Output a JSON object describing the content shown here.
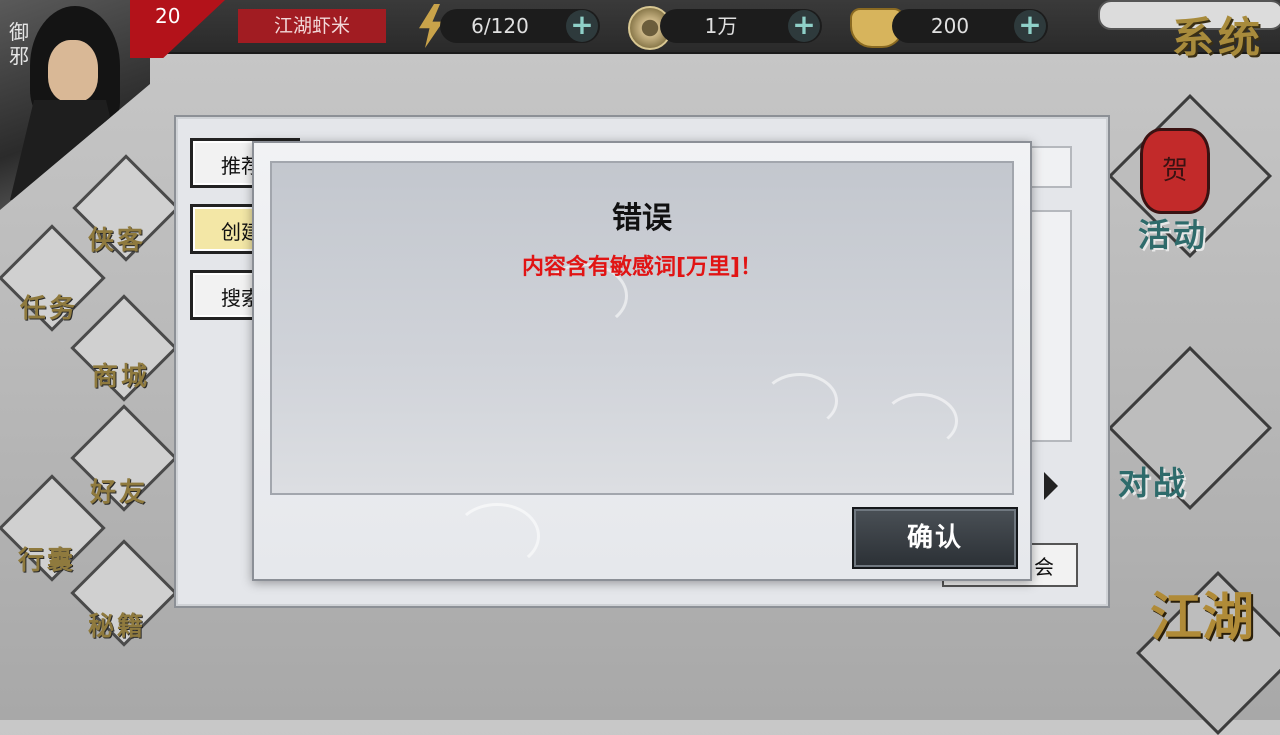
{
  "player": {
    "name": "御邪",
    "level": "20",
    "rank": "江湖虾米"
  },
  "resources": {
    "stamina": "6/120",
    "copper": "1万",
    "gold": "200",
    "add_symbol": "+"
  },
  "system_label": "系统",
  "left_menu": {
    "hero": "侠客",
    "task": "任务",
    "shop": "商城",
    "friends": "好友",
    "bag": "行囊",
    "manual": "秘籍"
  },
  "right_menu": {
    "activity": "活动",
    "lantern_char": "贺",
    "battle": "对战",
    "jianghu": "江湖"
  },
  "guild_panel": {
    "recommend": "推荐",
    "create": "创建",
    "search": "搜索",
    "join": "会"
  },
  "dialog": {
    "title": "错误",
    "message": "内容含有敏感词[万里]！",
    "confirm": "确认"
  },
  "colors": {
    "error_text": "#e11414",
    "rank_badge": "#a11c22",
    "gold_text": "#a88b3c",
    "teal_text": "#2e6b6b"
  }
}
